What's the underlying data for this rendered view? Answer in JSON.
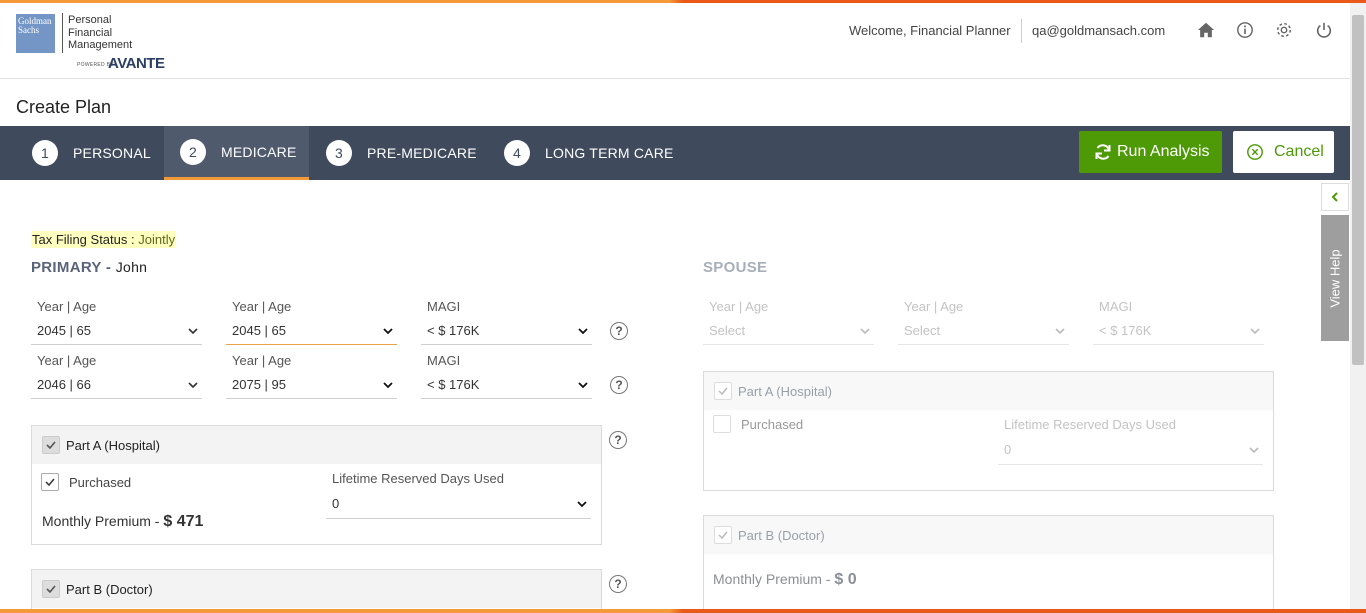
{
  "header": {
    "logo_line1": "Goldman",
    "logo_line2": "Sachs",
    "product_line1": "Personal",
    "product_line2": "Financial",
    "product_line3": "Management",
    "powered_by": "POWERED BY",
    "powered_brand": "AVANTE",
    "welcome": "Welcome, Financial Planner",
    "email": "qa@goldmansach.com",
    "icons": [
      "home-icon",
      "info-icon",
      "settings-icon",
      "power-icon"
    ]
  },
  "page_title": "Create Plan",
  "steps": [
    {
      "num": "1",
      "label": "PERSONAL"
    },
    {
      "num": "2",
      "label": "MEDICARE"
    },
    {
      "num": "3",
      "label": "PRE-MEDICARE"
    },
    {
      "num": "4",
      "label": "LONG TERM CARE"
    }
  ],
  "active_step": "MEDICARE",
  "actions": {
    "run": "Run Analysis",
    "cancel": "Cancel"
  },
  "help": {
    "view_help": "View Help"
  },
  "tax": {
    "label": "Tax Filing Status :",
    "value": "Jointly"
  },
  "primary": {
    "title": "PRIMARY -",
    "name": "John",
    "rows": [
      {
        "start_label": "Year  |  Age",
        "start_value": "2045 | 65",
        "end_label": "Year  |  Age",
        "end_value": "2045 | 65",
        "magi_label": "MAGI",
        "magi_value": "< $ 176K"
      },
      {
        "start_label": "Year  |  Age",
        "start_value": "2046 | 66",
        "end_label": "Year  |  Age",
        "end_value": "2075 | 95",
        "magi_label": "MAGI",
        "magi_value": "< $ 176K"
      }
    ],
    "part_a": {
      "title": "Part A (Hospital)",
      "purchased": "Purchased",
      "reserved_label": "Lifetime Reserved Days Used",
      "reserved_value": "0",
      "premium_label": "Monthly Premium -",
      "premium_value": "$ 471"
    },
    "part_b": {
      "title": "Part B (Doctor)"
    }
  },
  "spouse": {
    "title": "SPOUSE",
    "row": {
      "start_label": "Year  |  Age",
      "start_value": "Select",
      "end_label": "Year  |  Age",
      "end_value": "Select",
      "magi_label": "MAGI",
      "magi_value": "< $ 176K"
    },
    "part_a": {
      "title": "Part A (Hospital)",
      "purchased": "Purchased",
      "reserved_label": "Lifetime Reserved Days Used",
      "reserved_value": "0"
    },
    "part_b": {
      "title": "Part B (Doctor)",
      "premium_label": "Monthly Premium -",
      "premium_value": "$ 0"
    }
  },
  "colors": {
    "accent_green": "#4e9a06",
    "stepbar": "#3f4a5c",
    "active_underline": "#f29a3a",
    "tax_highlight": "#ffffbf"
  }
}
